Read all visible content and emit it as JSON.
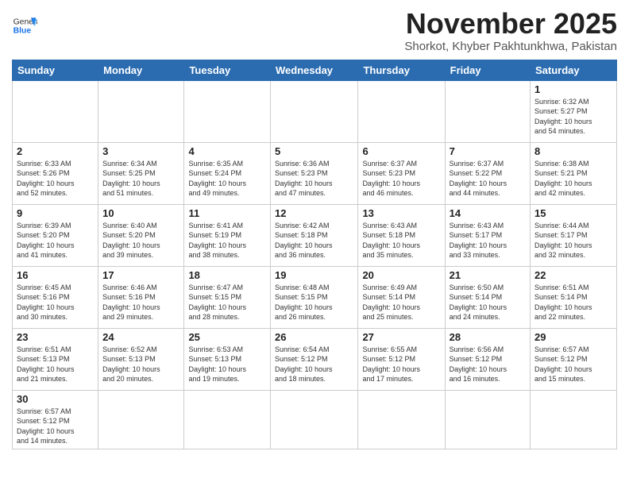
{
  "header": {
    "logo_general": "General",
    "logo_blue": "Blue",
    "month": "November 2025",
    "location": "Shorkot, Khyber Pakhtunkhwa, Pakistan"
  },
  "days_of_week": [
    "Sunday",
    "Monday",
    "Tuesday",
    "Wednesday",
    "Thursday",
    "Friday",
    "Saturday"
  ],
  "weeks": [
    [
      {
        "day": "",
        "info": ""
      },
      {
        "day": "",
        "info": ""
      },
      {
        "day": "",
        "info": ""
      },
      {
        "day": "",
        "info": ""
      },
      {
        "day": "",
        "info": ""
      },
      {
        "day": "",
        "info": ""
      },
      {
        "day": "1",
        "info": "Sunrise: 6:32 AM\nSunset: 5:27 PM\nDaylight: 10 hours\nand 54 minutes."
      }
    ],
    [
      {
        "day": "2",
        "info": "Sunrise: 6:33 AM\nSunset: 5:26 PM\nDaylight: 10 hours\nand 52 minutes."
      },
      {
        "day": "3",
        "info": "Sunrise: 6:34 AM\nSunset: 5:25 PM\nDaylight: 10 hours\nand 51 minutes."
      },
      {
        "day": "4",
        "info": "Sunrise: 6:35 AM\nSunset: 5:24 PM\nDaylight: 10 hours\nand 49 minutes."
      },
      {
        "day": "5",
        "info": "Sunrise: 6:36 AM\nSunset: 5:23 PM\nDaylight: 10 hours\nand 47 minutes."
      },
      {
        "day": "6",
        "info": "Sunrise: 6:37 AM\nSunset: 5:23 PM\nDaylight: 10 hours\nand 46 minutes."
      },
      {
        "day": "7",
        "info": "Sunrise: 6:37 AM\nSunset: 5:22 PM\nDaylight: 10 hours\nand 44 minutes."
      },
      {
        "day": "8",
        "info": "Sunrise: 6:38 AM\nSunset: 5:21 PM\nDaylight: 10 hours\nand 42 minutes."
      }
    ],
    [
      {
        "day": "9",
        "info": "Sunrise: 6:39 AM\nSunset: 5:20 PM\nDaylight: 10 hours\nand 41 minutes."
      },
      {
        "day": "10",
        "info": "Sunrise: 6:40 AM\nSunset: 5:20 PM\nDaylight: 10 hours\nand 39 minutes."
      },
      {
        "day": "11",
        "info": "Sunrise: 6:41 AM\nSunset: 5:19 PM\nDaylight: 10 hours\nand 38 minutes."
      },
      {
        "day": "12",
        "info": "Sunrise: 6:42 AM\nSunset: 5:18 PM\nDaylight: 10 hours\nand 36 minutes."
      },
      {
        "day": "13",
        "info": "Sunrise: 6:43 AM\nSunset: 5:18 PM\nDaylight: 10 hours\nand 35 minutes."
      },
      {
        "day": "14",
        "info": "Sunrise: 6:43 AM\nSunset: 5:17 PM\nDaylight: 10 hours\nand 33 minutes."
      },
      {
        "day": "15",
        "info": "Sunrise: 6:44 AM\nSunset: 5:17 PM\nDaylight: 10 hours\nand 32 minutes."
      }
    ],
    [
      {
        "day": "16",
        "info": "Sunrise: 6:45 AM\nSunset: 5:16 PM\nDaylight: 10 hours\nand 30 minutes."
      },
      {
        "day": "17",
        "info": "Sunrise: 6:46 AM\nSunset: 5:16 PM\nDaylight: 10 hours\nand 29 minutes."
      },
      {
        "day": "18",
        "info": "Sunrise: 6:47 AM\nSunset: 5:15 PM\nDaylight: 10 hours\nand 28 minutes."
      },
      {
        "day": "19",
        "info": "Sunrise: 6:48 AM\nSunset: 5:15 PM\nDaylight: 10 hours\nand 26 minutes."
      },
      {
        "day": "20",
        "info": "Sunrise: 6:49 AM\nSunset: 5:14 PM\nDaylight: 10 hours\nand 25 minutes."
      },
      {
        "day": "21",
        "info": "Sunrise: 6:50 AM\nSunset: 5:14 PM\nDaylight: 10 hours\nand 24 minutes."
      },
      {
        "day": "22",
        "info": "Sunrise: 6:51 AM\nSunset: 5:14 PM\nDaylight: 10 hours\nand 22 minutes."
      }
    ],
    [
      {
        "day": "23",
        "info": "Sunrise: 6:51 AM\nSunset: 5:13 PM\nDaylight: 10 hours\nand 21 minutes."
      },
      {
        "day": "24",
        "info": "Sunrise: 6:52 AM\nSunset: 5:13 PM\nDaylight: 10 hours\nand 20 minutes."
      },
      {
        "day": "25",
        "info": "Sunrise: 6:53 AM\nSunset: 5:13 PM\nDaylight: 10 hours\nand 19 minutes."
      },
      {
        "day": "26",
        "info": "Sunrise: 6:54 AM\nSunset: 5:12 PM\nDaylight: 10 hours\nand 18 minutes."
      },
      {
        "day": "27",
        "info": "Sunrise: 6:55 AM\nSunset: 5:12 PM\nDaylight: 10 hours\nand 17 minutes."
      },
      {
        "day": "28",
        "info": "Sunrise: 6:56 AM\nSunset: 5:12 PM\nDaylight: 10 hours\nand 16 minutes."
      },
      {
        "day": "29",
        "info": "Sunrise: 6:57 AM\nSunset: 5:12 PM\nDaylight: 10 hours\nand 15 minutes."
      }
    ],
    [
      {
        "day": "30",
        "info": "Sunrise: 6:57 AM\nSunset: 5:12 PM\nDaylight: 10 hours\nand 14 minutes."
      },
      {
        "day": "",
        "info": ""
      },
      {
        "day": "",
        "info": ""
      },
      {
        "day": "",
        "info": ""
      },
      {
        "day": "",
        "info": ""
      },
      {
        "day": "",
        "info": ""
      },
      {
        "day": "",
        "info": ""
      }
    ]
  ]
}
